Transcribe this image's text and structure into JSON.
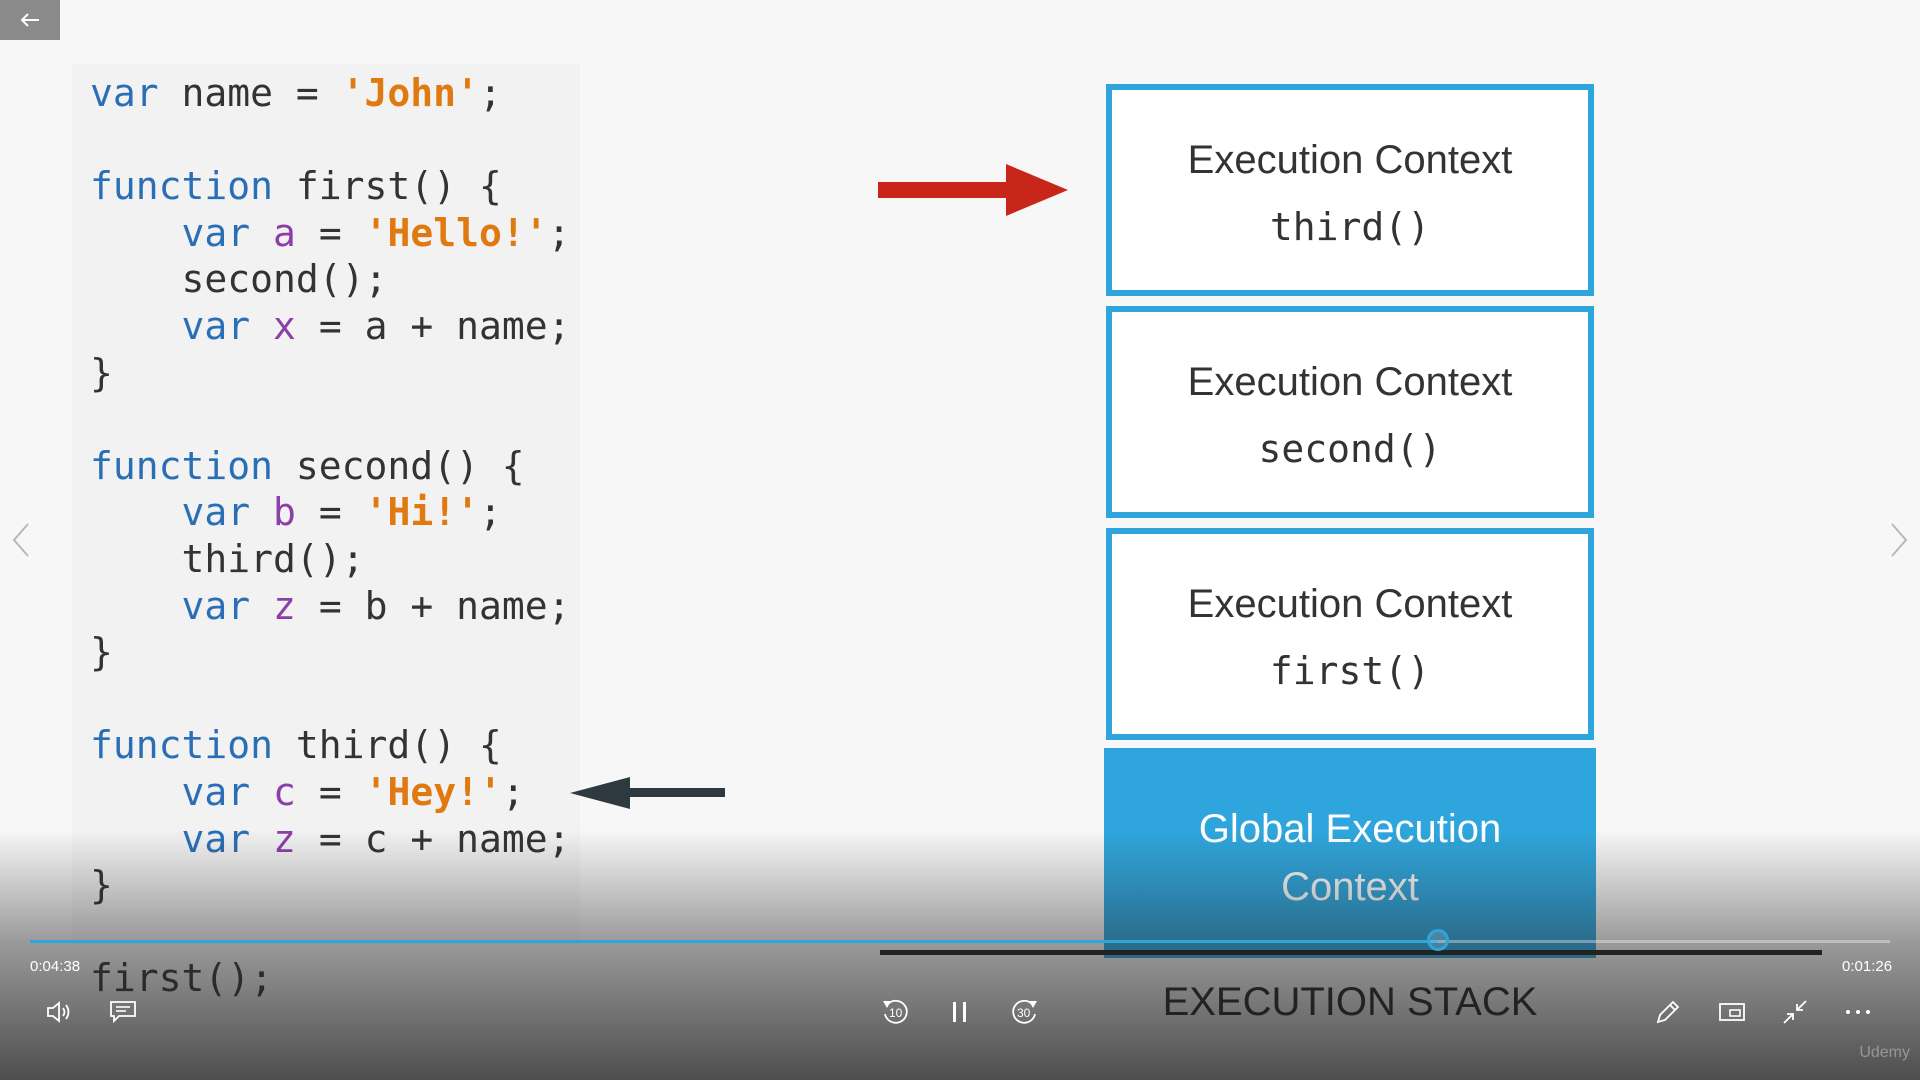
{
  "slide": {
    "code_lines": [
      [
        {
          "t": "var",
          "c": "kw"
        },
        {
          "t": " name = ",
          "c": "plain"
        },
        {
          "t": "'John'",
          "c": "str"
        },
        {
          "t": ";",
          "c": "plain"
        }
      ],
      [],
      [
        {
          "t": "function",
          "c": "kw"
        },
        {
          "t": " first() {",
          "c": "plain"
        }
      ],
      [
        {
          "t": "    ",
          "c": "plain"
        },
        {
          "t": "var",
          "c": "kw"
        },
        {
          "t": " ",
          "c": "plain"
        },
        {
          "t": "a",
          "c": "vr"
        },
        {
          "t": " = ",
          "c": "plain"
        },
        {
          "t": "'Hello!'",
          "c": "str"
        },
        {
          "t": ";",
          "c": "plain"
        }
      ],
      [
        {
          "t": "    second();",
          "c": "plain"
        }
      ],
      [
        {
          "t": "    ",
          "c": "plain"
        },
        {
          "t": "var",
          "c": "kw"
        },
        {
          "t": " ",
          "c": "plain"
        },
        {
          "t": "x",
          "c": "vr"
        },
        {
          "t": " = a + name;",
          "c": "plain"
        }
      ],
      [
        {
          "t": "}",
          "c": "plain"
        }
      ],
      [],
      [
        {
          "t": "function",
          "c": "kw"
        },
        {
          "t": " second() {",
          "c": "plain"
        }
      ],
      [
        {
          "t": "    ",
          "c": "plain"
        },
        {
          "t": "var",
          "c": "kw"
        },
        {
          "t": " ",
          "c": "plain"
        },
        {
          "t": "b",
          "c": "vr"
        },
        {
          "t": " = ",
          "c": "plain"
        },
        {
          "t": "'Hi!'",
          "c": "str"
        },
        {
          "t": ";",
          "c": "plain"
        }
      ],
      [
        {
          "t": "    third();",
          "c": "plain"
        }
      ],
      [
        {
          "t": "    ",
          "c": "plain"
        },
        {
          "t": "var",
          "c": "kw"
        },
        {
          "t": " ",
          "c": "plain"
        },
        {
          "t": "z",
          "c": "vr"
        },
        {
          "t": " = b + name;",
          "c": "plain"
        }
      ],
      [
        {
          "t": "}",
          "c": "plain"
        }
      ],
      [],
      [
        {
          "t": "function",
          "c": "kw"
        },
        {
          "t": " third() {",
          "c": "plain"
        }
      ],
      [
        {
          "t": "    ",
          "c": "plain"
        },
        {
          "t": "var",
          "c": "kw"
        },
        {
          "t": " ",
          "c": "plain"
        },
        {
          "t": "c",
          "c": "vr"
        },
        {
          "t": " = ",
          "c": "plain"
        },
        {
          "t": "'Hey!'",
          "c": "str"
        },
        {
          "t": ";",
          "c": "plain"
        }
      ],
      [
        {
          "t": "    ",
          "c": "plain"
        },
        {
          "t": "var",
          "c": "kw"
        },
        {
          "t": " ",
          "c": "plain"
        },
        {
          "t": "z",
          "c": "vr"
        },
        {
          "t": " = c + name;",
          "c": "plain"
        }
      ],
      [
        {
          "t": "}",
          "c": "plain"
        }
      ],
      [],
      [
        {
          "t": "first();",
          "c": "plain"
        }
      ]
    ],
    "stack": [
      {
        "title": "Execution Context",
        "fn": "third()"
      },
      {
        "title": "Execution Context",
        "fn": "second()"
      },
      {
        "title": "Execution Context",
        "fn": "first()"
      }
    ],
    "global_label": "Global Execution Context",
    "stack_label": "EXECUTION STACK",
    "colors": {
      "keyword": "#2a6fb5",
      "string": "#e07a10",
      "variable": "#8c3fa8",
      "box_border": "#2ea6dd",
      "red_arrow": "#c9261a",
      "dark_arrow": "#2f3a40"
    }
  },
  "player": {
    "elapsed": "0:04:38",
    "remaining": "0:01:26",
    "progress": 0.757,
    "rewind_label": "10",
    "forward_label": "30",
    "watermark": "Udemy"
  }
}
